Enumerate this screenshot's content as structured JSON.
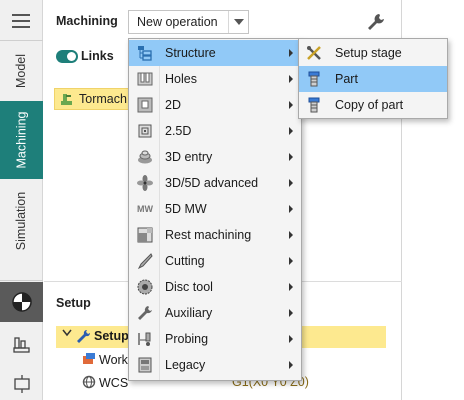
{
  "leftbar": {
    "tabs": [
      {
        "label": "Model",
        "active": false
      },
      {
        "label": "Machining",
        "active": true
      },
      {
        "label": "Simulation",
        "active": false
      }
    ]
  },
  "header": {
    "title": "Machining",
    "combo_value": "New operation"
  },
  "links": {
    "label": "Links",
    "enabled": true
  },
  "tree": {
    "item_label": "Tormach"
  },
  "setup": {
    "title": "Setup",
    "row_label": "Setup",
    "child_workpiece": "Work",
    "child_wcs": "WCS",
    "wcs_value": "G1(X0 Y0 Z0)"
  },
  "menu": {
    "items": [
      {
        "label": "Structure",
        "icon": "structure-icon",
        "highlighted": true
      },
      {
        "label": "Holes",
        "icon": "holes-icon"
      },
      {
        "label": "2D",
        "icon": "2d-icon"
      },
      {
        "label": "2.5D",
        "icon": "2-5d-icon"
      },
      {
        "label": "3D entry",
        "icon": "3d-entry-icon"
      },
      {
        "label": "3D/5D advanced",
        "icon": "fan-icon"
      },
      {
        "label": "5D MW",
        "icon": "mw-icon"
      },
      {
        "label": "Rest machining",
        "icon": "rest-machining-icon"
      },
      {
        "label": "Cutting",
        "icon": "knife-icon"
      },
      {
        "label": "Disc tool",
        "icon": "disc-icon"
      },
      {
        "label": "Auxiliary",
        "icon": "wrench-icon"
      },
      {
        "label": "Probing",
        "icon": "probe-icon"
      },
      {
        "label": "Legacy",
        "icon": "legacy-icon"
      }
    ],
    "mw_icon_text": "MW"
  },
  "submenu": {
    "items": [
      {
        "label": "Setup stage",
        "icon": "tools-icon"
      },
      {
        "label": "Part",
        "icon": "part-icon",
        "highlighted": true
      },
      {
        "label": "Copy of part",
        "icon": "copy-part-icon"
      }
    ]
  },
  "colors": {
    "accent": "#1e7f7a",
    "highlight": "#91c9f7",
    "tree_selected": "#fde98f"
  }
}
